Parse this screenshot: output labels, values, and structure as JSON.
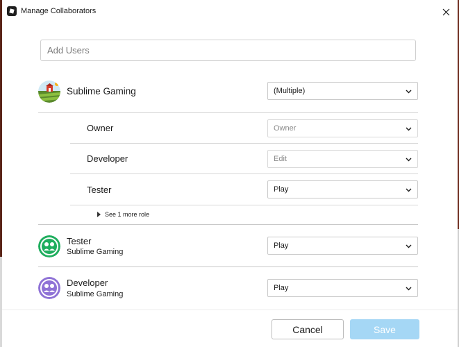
{
  "window": {
    "title": "Manage Collaborators",
    "app_icon": "roblox-studio-icon",
    "close_icon": "close-icon"
  },
  "search": {
    "placeholder": "Add Users",
    "value": ""
  },
  "group": {
    "name": "Sublime Gaming",
    "avatar_icon": "farm-group-icon",
    "permission": "(Multiple)",
    "roles": [
      {
        "name": "Owner",
        "permission": "Owner",
        "enabled": false
      },
      {
        "name": "Developer",
        "permission": "Edit",
        "enabled": false
      },
      {
        "name": "Tester",
        "permission": "Play",
        "enabled": true
      }
    ],
    "more_roles_label": "See 1 more role"
  },
  "role_entries": [
    {
      "role": "Tester",
      "group": "Sublime Gaming",
      "permission": "Play",
      "avatar_icon": "group-role-icon",
      "avatar_color": "#1fae5e"
    },
    {
      "role": "Developer",
      "group": "Sublime Gaming",
      "permission": "Play",
      "avatar_icon": "group-role-icon",
      "avatar_color": "#8f72d6"
    }
  ],
  "footer": {
    "cancel_label": "Cancel",
    "save_label": "Save"
  },
  "colors": {
    "save_disabled": "#a5d7f5",
    "tester_avatar": "#1fae5e",
    "developer_avatar": "#8f72d6"
  }
}
